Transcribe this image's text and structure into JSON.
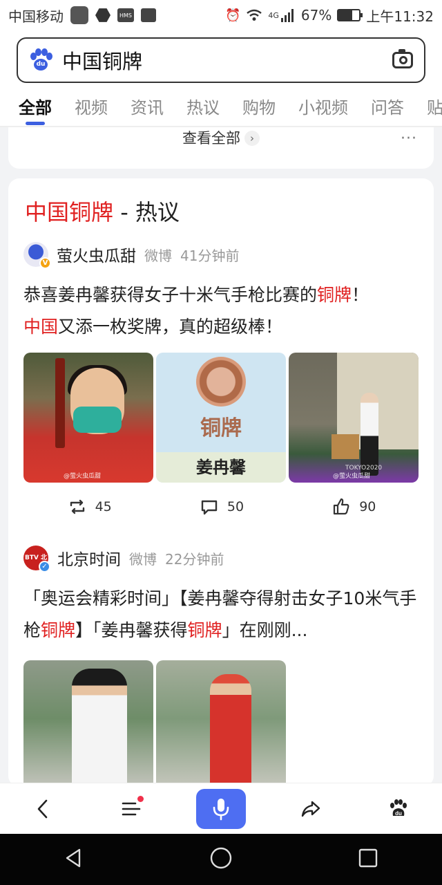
{
  "status_bar": {
    "carrier": "中国移动",
    "network": "4G",
    "battery": "67%",
    "battery_level": 0.67,
    "time": "上午11:32",
    "app_icons": [
      "app-icon",
      "hexagon-app-icon",
      "hms-icon",
      "gallery-icon"
    ]
  },
  "search": {
    "query": "中国铜牌",
    "logo": "baidu-paw-icon",
    "camera": "camera-icon"
  },
  "tabs": [
    {
      "label": "全部",
      "active": true
    },
    {
      "label": "视频"
    },
    {
      "label": "资讯"
    },
    {
      "label": "热议"
    },
    {
      "label": "购物"
    },
    {
      "label": "小视频"
    },
    {
      "label": "问答"
    },
    {
      "label": "贴"
    }
  ],
  "top_card": {
    "view_all": "查看全部",
    "more": "···"
  },
  "hot_card": {
    "title_highlight": "中国铜牌",
    "title_rest": " - 热议",
    "posts": [
      {
        "author": "萤火虫瓜甜",
        "source": "微博",
        "time": "41分钟前",
        "text_parts": [
          {
            "t": "恭喜姜冉馨获得女子十米气手枪比赛的"
          },
          {
            "t": "铜牌",
            "hl": true
          },
          {
            "t": "！"
          },
          {
            "t": "中国",
            "hl": true
          },
          {
            "t": "又添一枚奖牌，真的超级棒！"
          }
        ],
        "images": [
          {
            "kind": "shooter-masked",
            "watermark": "@萤火虫瓜甜"
          },
          {
            "kind": "bronze-medal",
            "label": "铜牌",
            "name": "姜冉馨"
          },
          {
            "kind": "shooting-range",
            "watermark": "@萤火虫瓜甜",
            "sign": "TOKYO2020"
          }
        ],
        "reposts": "45",
        "comments": "50",
        "likes": "90"
      },
      {
        "author": "北京时间",
        "source": "微博",
        "time": "22分钟前",
        "avatar_text": "BTV 北京",
        "text_parts": [
          {
            "t": "「奥运会精彩时间」【姜冉馨夺得射击女子10米气手枪"
          },
          {
            "t": "铜牌",
            "hl": true
          },
          {
            "t": "】「姜冉馨获得"
          },
          {
            "t": "铜牌",
            "hl": true
          },
          {
            "t": "」在刚刚..."
          }
        ],
        "images": [
          {
            "kind": "athlete-white"
          },
          {
            "kind": "athlete-red"
          }
        ]
      }
    ]
  },
  "toolbar": {
    "items": [
      "back-icon",
      "menu-icon",
      "voice-icon",
      "share-icon",
      "baidu-home-icon"
    ],
    "accent": "#4e6ef2"
  },
  "navbar": {
    "items": [
      "nav-back-icon",
      "nav-home-icon",
      "nav-recent-icon"
    ]
  },
  "colors": {
    "highlight": "#e02020",
    "accent": "#3c5fe0"
  }
}
